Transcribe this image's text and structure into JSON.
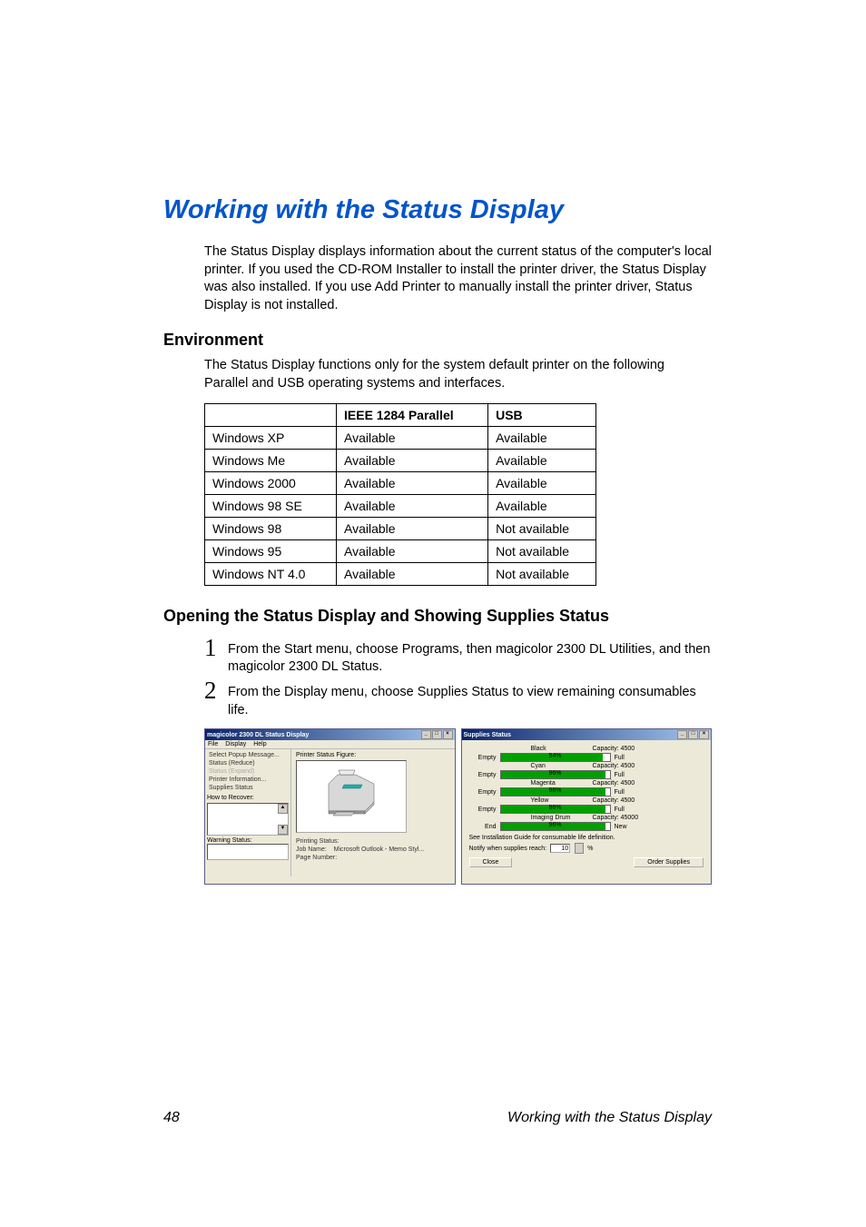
{
  "heading": "Working with the Status Display",
  "intro": "The Status Display displays information about the current status of the computer's local printer. If you used the CD-ROM Installer to install the printer driver, the Status Display was also installed. If you use Add Printer to manually install the printer driver, Status Display is not installed.",
  "env": {
    "title": "Environment",
    "note": "The Status Display functions only for the system default printer on the following Parallel and USB operating systems and interfaces.",
    "cols": [
      "",
      "IEEE 1284 Parallel",
      "USB"
    ],
    "rows": [
      [
        "Windows XP",
        "Available",
        "Available"
      ],
      [
        "Windows Me",
        "Available",
        "Available"
      ],
      [
        "Windows 2000",
        "Available",
        "Available"
      ],
      [
        "Windows 98 SE",
        "Available",
        "Available"
      ],
      [
        "Windows 98",
        "Available",
        "Not available"
      ],
      [
        "Windows 95",
        "Available",
        "Not available"
      ],
      [
        "Windows NT 4.0",
        "Available",
        "Not available"
      ]
    ]
  },
  "opening": {
    "title": "Opening the Status Display and Showing Supplies Status",
    "steps": [
      "From the Start menu, choose Programs, then magicolor 2300 DL Utilities, and then magicolor 2300 DL Status.",
      "From the Display menu, choose Supplies Status to view remaining consumables life."
    ]
  },
  "screenshot1": {
    "title": "magicolor 2300 DL Status Display",
    "menubar": [
      "File",
      "Display",
      "Help"
    ],
    "menuitems": [
      {
        "label": "Select Popup Message...",
        "disabled": false
      },
      {
        "label": "Status (Reduce)",
        "disabled": false
      },
      {
        "label": "Status (Expand)",
        "disabled": true
      },
      {
        "label": "Printer Information...",
        "disabled": false
      },
      {
        "label": "Supplies Status",
        "disabled": false
      }
    ],
    "recover": "How to Recover:",
    "warning": "Warning Status:",
    "figureLabel": "Printer Status Figure:",
    "printingStatus": "Printing Status:",
    "jobNameLabel": "Job Name:",
    "jobNameValue": "Microsoft Outlook - Memo Styl...",
    "pageNumber": "Page Number:"
  },
  "screenshot2": {
    "title": "Supplies Status",
    "supplies": [
      {
        "name": "Black",
        "capacity": "Capacity: 4500",
        "pct": "94%",
        "fill": 94,
        "color": "#00a000",
        "left": "Empty",
        "right": "Full"
      },
      {
        "name": "Cyan",
        "capacity": "Capacity: 4500",
        "pct": "96%",
        "fill": 96,
        "color": "#00a000",
        "left": "Empty",
        "right": "Full"
      },
      {
        "name": "Magenta",
        "capacity": "Capacity: 4500",
        "pct": "96%",
        "fill": 96,
        "color": "#00a000",
        "left": "Empty",
        "right": "Full"
      },
      {
        "name": "Yellow",
        "capacity": "Capacity: 4500",
        "pct": "96%",
        "fill": 96,
        "color": "#00a000",
        "left": "Empty",
        "right": "Full"
      },
      {
        "name": "Imaging Drum",
        "capacity": "Capacity: 45000",
        "pct": "96%",
        "fill": 96,
        "color": "#00a000",
        "left": "End",
        "right": "New"
      }
    ],
    "note": "See Installation Guide for consumable life definition.",
    "notifyLabel": "Notify when supplies reach:",
    "notifyValue": "10",
    "notifyUnit": "%",
    "closeBtn": "Close",
    "orderBtn": "Order Supplies"
  },
  "footer": {
    "page": "48",
    "label": "Working with the Status Display"
  }
}
